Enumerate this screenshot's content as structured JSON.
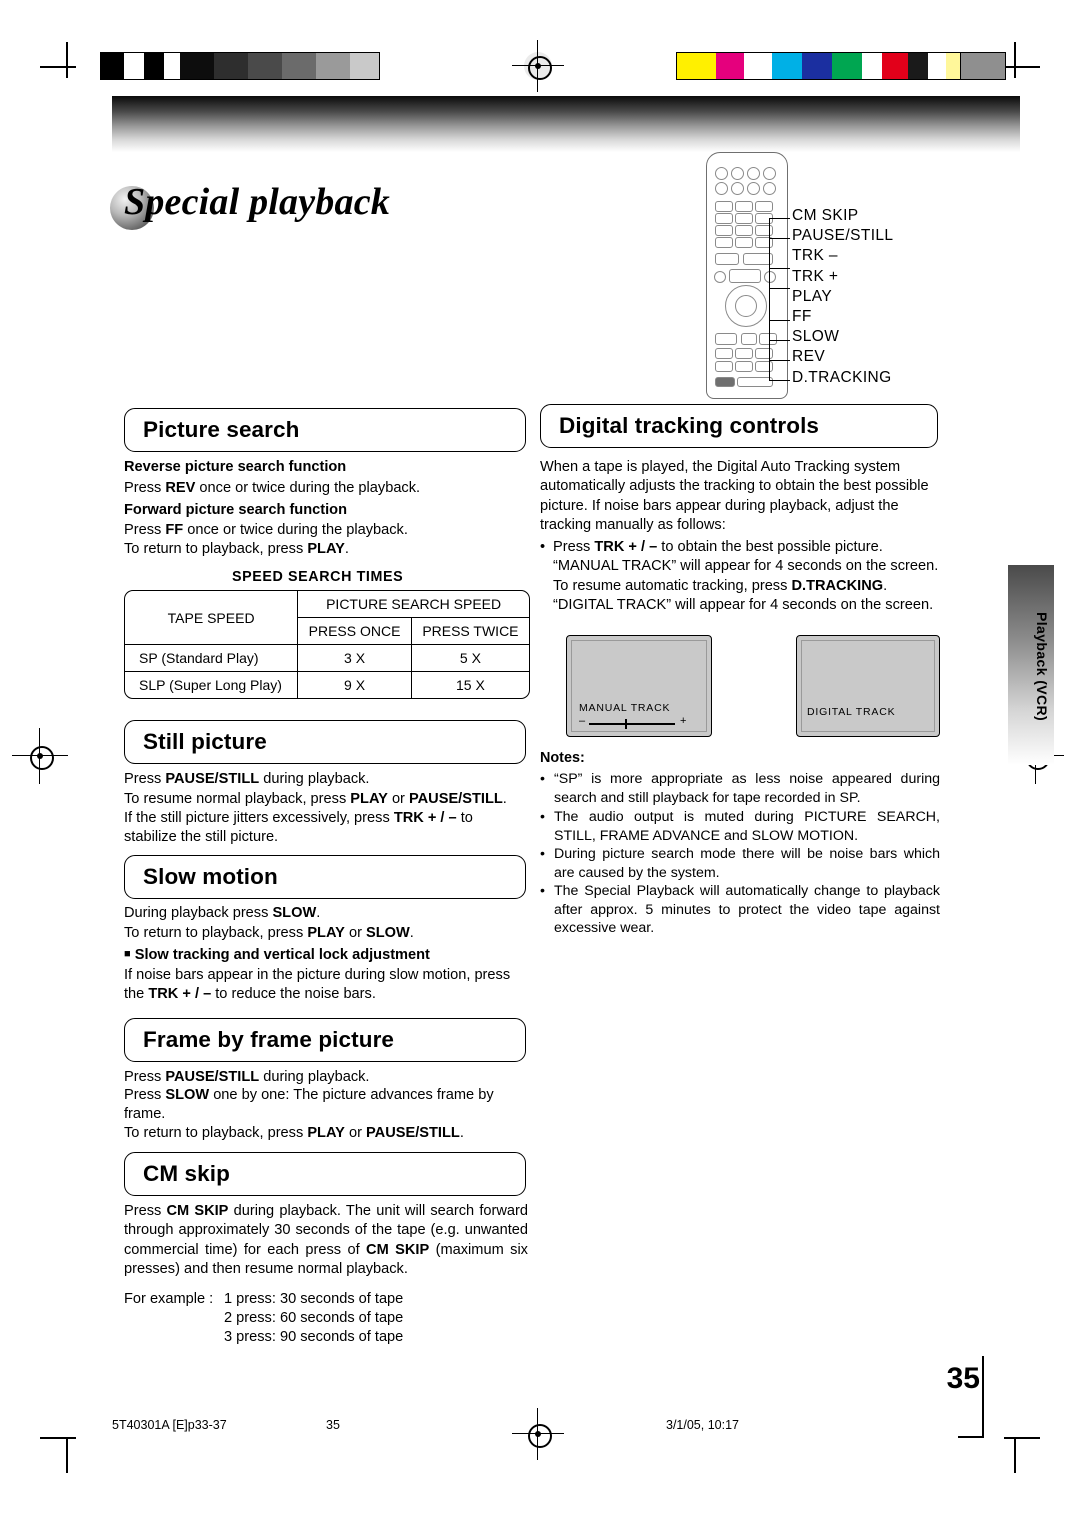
{
  "page": {
    "title": "Special playback",
    "number": "35",
    "side_tab": "Playback (VCR)"
  },
  "remote_callouts": [
    "CM SKIP",
    "PAUSE/STILL",
    "TRK –",
    "TRK +",
    "PLAY",
    "FF",
    "SLOW",
    "REV",
    "D.TRACKING"
  ],
  "sections": {
    "picture_search": {
      "heading": "Picture search",
      "sub1": "Reverse picture search function",
      "line1": "Press REV once or twice during the playback.",
      "sub2": "Forward picture search function",
      "line2": "Press FF once or twice during the playback.",
      "line3": "To return to playback, press PLAY."
    },
    "speed_table": {
      "caption": "SPEED SEARCH TIMES",
      "col_tape": "TAPE SPEED",
      "col_group": "PICTURE SEARCH SPEED",
      "col_once": "PRESS ONCE",
      "col_twice": "PRESS TWICE",
      "rows": [
        {
          "tape": "SP (Standard Play)",
          "once": "3 X",
          "twice": "5 X"
        },
        {
          "tape": "SLP (Super Long Play)",
          "once": "9 X",
          "twice": "15 X"
        }
      ]
    },
    "still_picture": {
      "heading": "Still picture",
      "line1": "Press PAUSE/STILL during playback.",
      "line2": "To resume normal playback, press PLAY or PAUSE/STILL.",
      "line3": "If the still picture jitters excessively, press TRK + / – to stabilize the still picture."
    },
    "slow_motion": {
      "heading": "Slow motion",
      "line1": "During playback press SLOW.",
      "line2": "To return to playback, press PLAY or SLOW.",
      "sub1": "Slow tracking and vertical lock adjustment",
      "line3": "If noise bars appear in the picture during slow motion, press the TRK + / – to reduce the noise bars."
    },
    "frame_by_frame": {
      "heading": "Frame by frame picture",
      "line1": "Press PAUSE/STILL during playback.",
      "line2": "Press SLOW one by one: The picture advances frame by frame.",
      "line3": "To return to playback, press PLAY or PAUSE/STILL."
    },
    "cm_skip": {
      "heading": "CM skip",
      "line1": "Press CM SKIP during playback. The unit will search forward through approximately 30 seconds of the tape (e.g. unwanted commercial time) for each press of CM SKIP (maximum six presses) and then resume normal playback.",
      "example_label": "For example :",
      "examples": [
        "1 press: 30 seconds of tape",
        "2 press: 60 seconds of tape",
        "3 press: 90 seconds of tape"
      ]
    },
    "digital_tracking": {
      "heading": "Digital tracking controls",
      "para": "When a tape is played, the Digital Auto Tracking system automatically adjusts the tracking to obtain the best possible picture. If noise bars appear during playback, adjust the tracking manually as follows:",
      "bullet": "Press TRK + / – to obtain the best possible picture. “MANUAL TRACK” will appear for 4 seconds on the screen. To resume automatic tracking, press D.TRACKING. “DIGITAL TRACK” will appear for 4 seconds on the screen.",
      "tv1_caption": "MANUAL  TRACK",
      "tv1_minus": "–",
      "tv1_plus": "+",
      "tv2_caption": "DIGITAL  TRACK"
    },
    "notes": {
      "title": "Notes:",
      "items": [
        "“SP” is more appropriate as less noise appeared during search and still playback for tape recorded in SP.",
        "The audio output is muted during PICTURE SEARCH, STILL, FRAME ADVANCE and SLOW MOTION.",
        "During picture search mode there will be noise bars which are caused by the system.",
        "The Special Playback will automatically change to playback after approx. 5 minutes to protect the video tape against excessive wear."
      ]
    }
  },
  "footer": {
    "left": "5T40301A [E]p33-37",
    "center": "35",
    "right": "3/1/05, 10:17"
  },
  "colors": {
    "ink": "#000000",
    "swatch_c": "#00a7e1",
    "swatch_m": "#e5007d",
    "swatch_y": "#fff000",
    "swatch_k": "#1a1a1a"
  }
}
